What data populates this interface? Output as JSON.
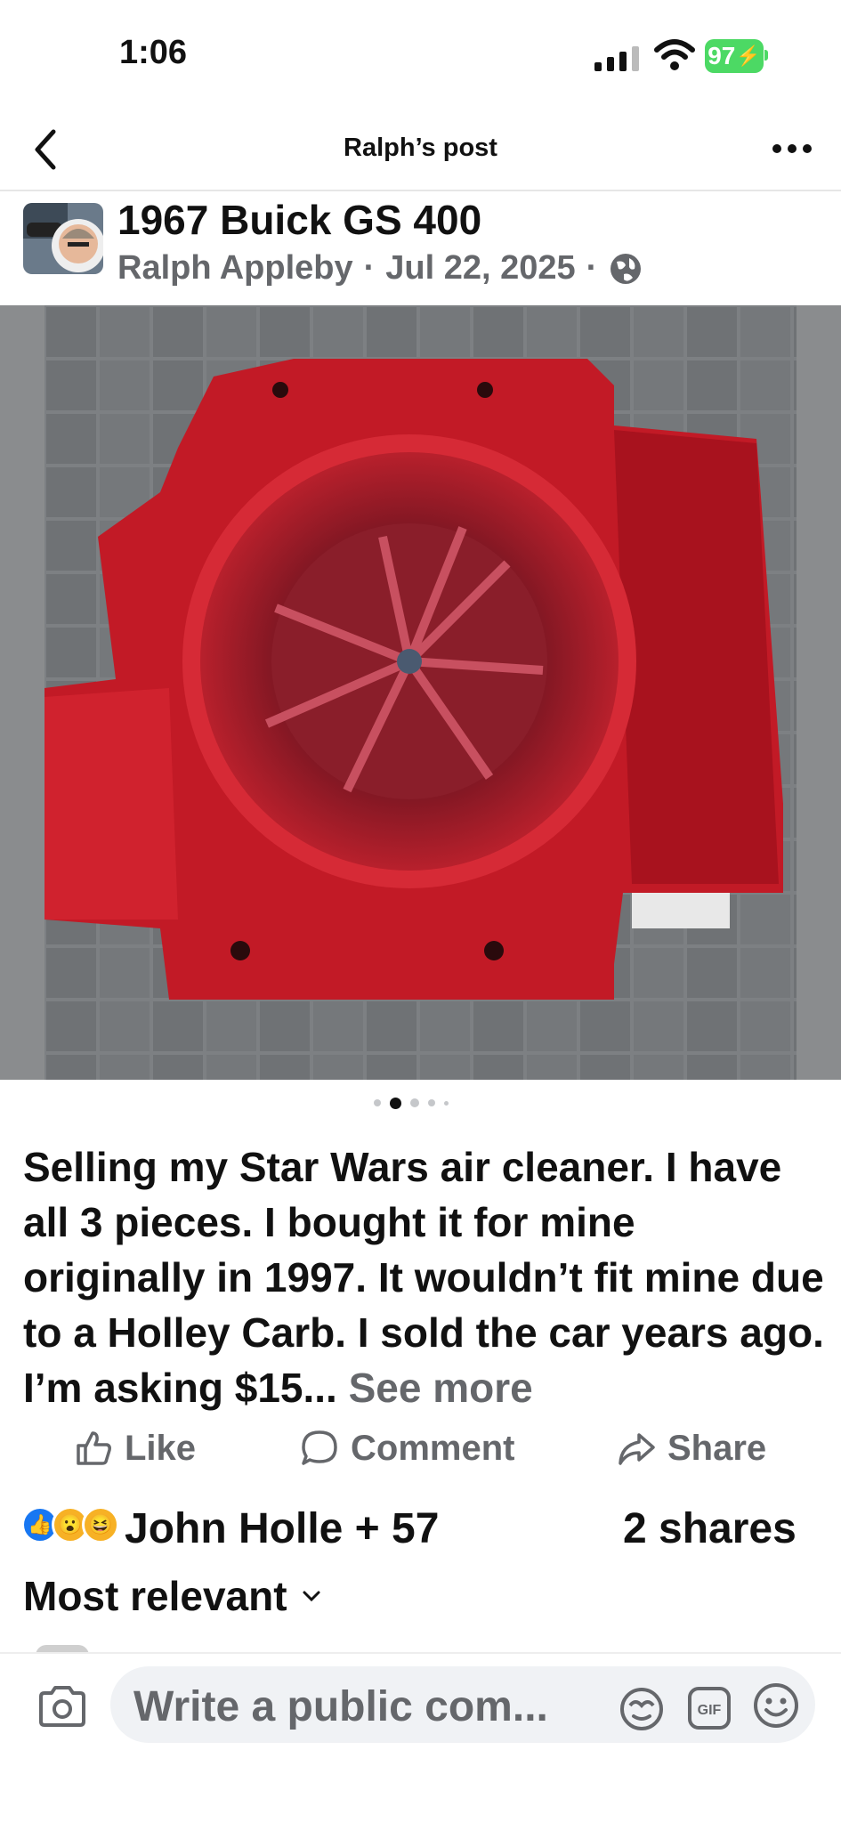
{
  "status_bar": {
    "time": "1:06",
    "battery": "97"
  },
  "nav": {
    "title": "Ralph’s post"
  },
  "post": {
    "title": "1967 Buick GS 400",
    "author": "Ralph Appleby",
    "date": "Jul 22, 2025",
    "separator": "·",
    "body": "Selling my Star Wars air cleaner. I have all 3 pieces. I bought it for mine originally in 1997. It wouldn’t fit mine due to a Holley Carb. I sold the car years ago. I’m asking $15...",
    "see_more": "See more",
    "carousel": {
      "count": 5,
      "active_index": 1
    }
  },
  "actions": {
    "like": "Like",
    "comment": "Comment",
    "share": "Share"
  },
  "engagement": {
    "reactors": "John Holle + 57",
    "shares": "2 shares"
  },
  "comments": {
    "sort_label": "Most relevant"
  },
  "composer": {
    "placeholder": "Write a public com..."
  },
  "colors": {
    "accent": "#1877f2",
    "battery": "#4cd964",
    "secondary_text": "#65676b"
  }
}
